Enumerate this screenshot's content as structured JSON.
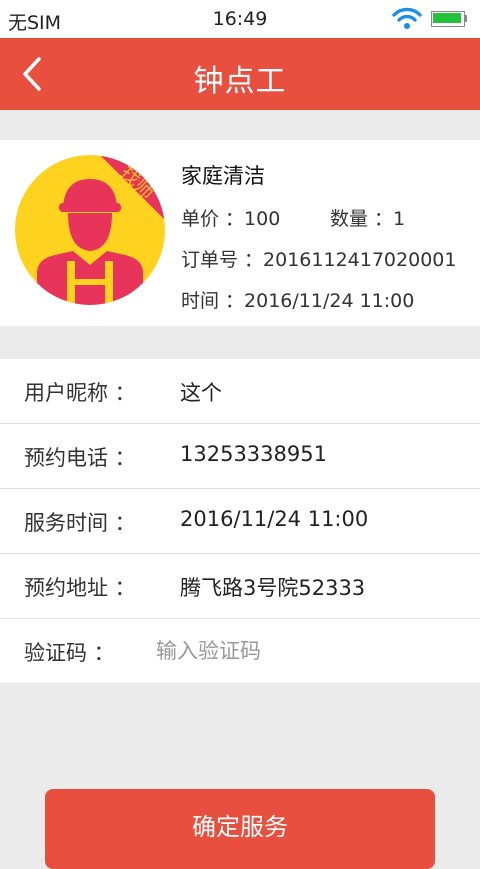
{
  "status_bar": {
    "carrier": "无SIM",
    "time": "16:49"
  },
  "nav": {
    "title": "钟点工",
    "back_icon": "chevron-left-icon"
  },
  "service": {
    "name": "家庭清洁",
    "price_label": "单价 ：",
    "price": "100",
    "quantity_label": "数量 ：",
    "quantity": "1",
    "order_label": "订单号 ：",
    "order_number": "2016112417020001",
    "time_label": "时间 ：",
    "time": "2016/11/24 11:00",
    "avatar_ribbon": "找师",
    "avatar_icon": "worker-avatar-icon"
  },
  "details": {
    "nickname_label": "用户昵称 ：",
    "nickname": "这个",
    "phone_label": "预约电话 ：",
    "phone": "13253338951",
    "service_time_label": "服务时间 ：",
    "service_time": "2016/11/24 11:00",
    "address_label": "预约地址 ：",
    "address": "腾飞路3号院52333",
    "code_label": "验证码 ：",
    "code_placeholder": "输入验证码",
    "code_value": ""
  },
  "confirm_button": "确定服务",
  "colors": {
    "brand_red": "#e84f3e",
    "avatar_yellow": "#ffd21f",
    "avatar_pink": "#e8335a",
    "background": "#ebebeb"
  }
}
